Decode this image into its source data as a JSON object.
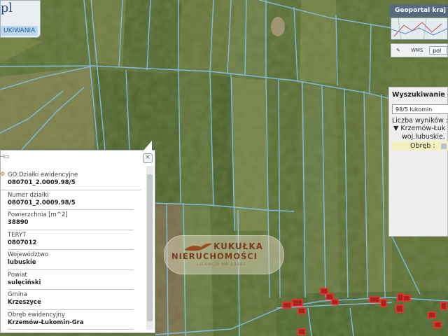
{
  "logo": {
    "text": ".pl",
    "button_label": "UKIWANIA"
  },
  "geoportal": {
    "title": "Geoportal kraj",
    "language": "pol",
    "tools": [
      "pencil-icon",
      "wms-icon"
    ],
    "wms_label": "WMS"
  },
  "search_panel": {
    "title": "Wyszukiwanie d",
    "query": "98/5 łukomin",
    "results_count_label": "Liczba wyników :",
    "tree_item": "Krzemów-Łuk",
    "tree_sub": "woj.lubuskie,",
    "obreb_label": "Obręb :"
  },
  "popup": {
    "group_label": "GO:Działki ewidencyjne",
    "group_value": "080701_2.0009.98/5",
    "fields": [
      {
        "label": "Numer działki",
        "value": "080701_2.0009.98/5"
      },
      {
        "label": "Powierzchnia [m^2]",
        "value": "38890"
      },
      {
        "label": "TERYT",
        "value": "0807012"
      },
      {
        "label": "Województwo",
        "value": "lubuskie"
      },
      {
        "label": "Powiat",
        "value": "sulęciński"
      },
      {
        "label": "Gmina",
        "value": "Krzeszyce"
      },
      {
        "label": "Obręb ewidencyjny",
        "value": "Krzemów-Łukomin-Gra"
      }
    ]
  },
  "watermark": {
    "name_line1": "KUKUŁKA",
    "name_line2": "NIERUCHOMOŚCI",
    "tagline": "LICENCJA NR 13161"
  },
  "colors": {
    "parcel_line": "#7fc0ea",
    "building": "#ff2a2a",
    "panel_header": "#566b80"
  }
}
